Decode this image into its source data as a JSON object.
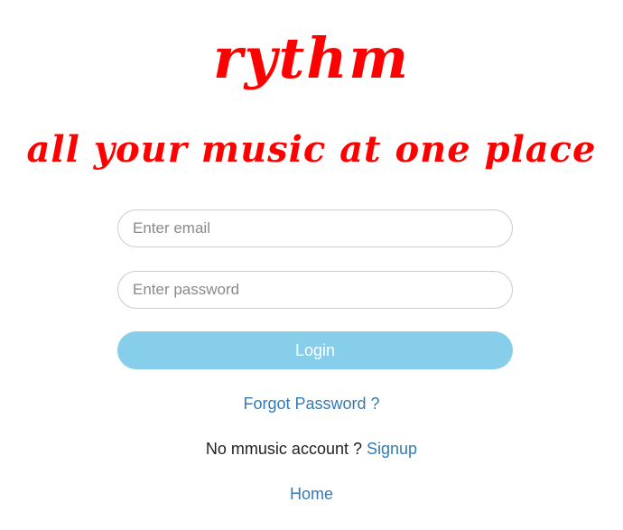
{
  "brand": {
    "title": "rythm",
    "tagline": "all your music at one place",
    "color": "#ff0000"
  },
  "form": {
    "email": {
      "placeholder": "Enter email",
      "value": ""
    },
    "password": {
      "placeholder": "Enter password",
      "value": ""
    },
    "login_label": "Login",
    "login_color": "#87ceeb"
  },
  "links": {
    "forgot_password": "Forgot Password ?",
    "no_account_text": "No mmusic account ?",
    "signup": "Signup",
    "home": "Home",
    "link_color": "#337ab7"
  }
}
